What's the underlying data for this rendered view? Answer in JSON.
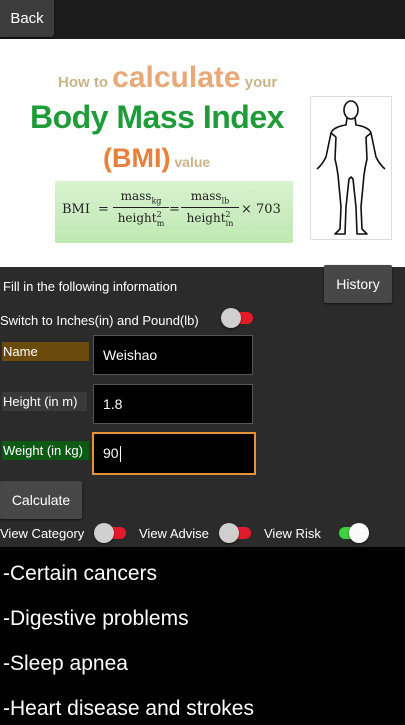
{
  "header": {
    "back_label": "Back"
  },
  "banner": {
    "howto_pre": "How to ",
    "howto_big": "calculate",
    "howto_post": " your",
    "title": "Body Mass Index",
    "bmi": "(BMI)",
    "value_word": " value",
    "formula": {
      "lhs": "BMI",
      "eq": "=",
      "num1": "mass",
      "num1_sub": "kg",
      "den1": "height",
      "den1_sub": "m",
      "num2": "mass",
      "num2_sub": "lb",
      "den2": "height",
      "den2_sub": "in",
      "sup": "2",
      "times": "× 703"
    }
  },
  "form": {
    "info_label": "Fill in the following information",
    "history_label": "History",
    "switch_label": "Switch to Inches(in) and Pound(lb)",
    "fields": [
      {
        "label": "Name",
        "value": "Weishao",
        "label_color": "#6b4a0e"
      },
      {
        "label": "Height (in m)",
        "value": "1.8",
        "label_color": "#3a3a3a"
      },
      {
        "label": "Weight (in kg)",
        "value": "90",
        "label_color": "#0e5a14"
      }
    ],
    "calculate_label": "Calculate",
    "views": [
      {
        "label": "View Category",
        "on": false
      },
      {
        "label": "View Advise",
        "on": false
      },
      {
        "label": "View Risk",
        "on": true
      }
    ]
  },
  "results": {
    "items": [
      "-Certain cancers",
      "-Digestive problems",
      "-Sleep apnea",
      "-Heart disease and strokes"
    ]
  },
  "colors": {
    "toggle_off_track": "#e21b2a",
    "toggle_on_track": "#3fd13f",
    "focus_border": "#e5913a",
    "title_green": "#1f9b3a"
  }
}
